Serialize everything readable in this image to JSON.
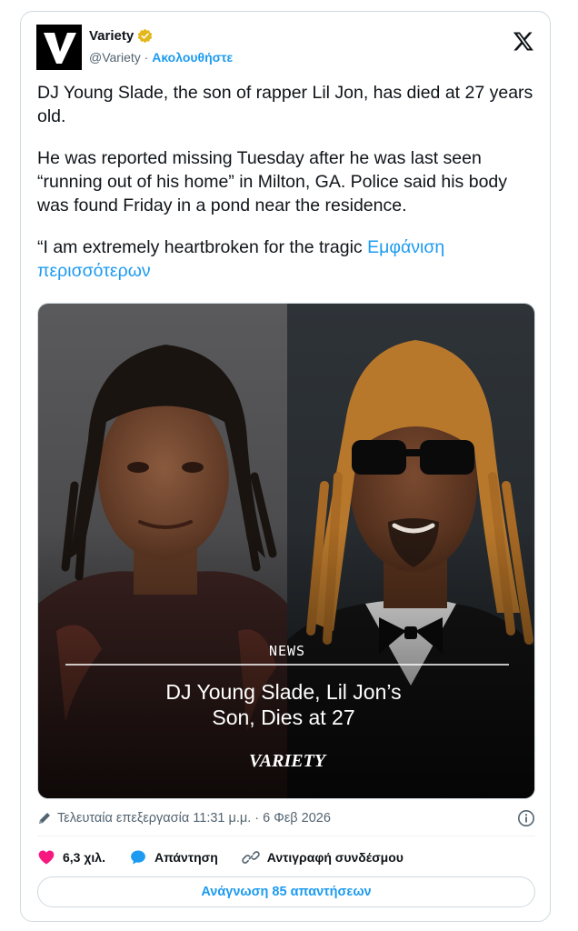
{
  "author": {
    "display_name": "Variety",
    "handle": "@Variety",
    "separator": "·",
    "follow_label": "Ακολουθήστε",
    "avatar_letter": "V"
  },
  "tweet": {
    "paragraphs": [
      "DJ Young Slade, the son of rapper Lil Jon, has died at 27 years old.",
      "He was reported missing Tuesday after he was last seen “running out of his home” in Milton, GA. Police said his body was found Friday in a pond near the residence."
    ],
    "last_paragraph": "“I am extremely heartbroken for the tragic ",
    "show_more": "Εμφάνιση περισσότερων"
  },
  "media": {
    "tag": "NEWS",
    "headline_line1": "DJ Young Slade, Lil Jon’s",
    "headline_line2": "Son, Dies at 27",
    "brand": "VARIETY"
  },
  "meta": {
    "edited": "Τελευταία επεξεργασία 11:31 μ.μ. · 6 Φεβ 2026"
  },
  "actions": {
    "likes": "6,3 χιλ.",
    "reply": "Απάντηση",
    "copy_link": "Αντιγραφή συνδέσμου"
  },
  "read_replies": "Ανάγνωση 85 απαντήσεων",
  "colors": {
    "accent": "#1d9bf0",
    "like": "#f91880",
    "verified": "#e2b719",
    "muted": "#536471"
  }
}
